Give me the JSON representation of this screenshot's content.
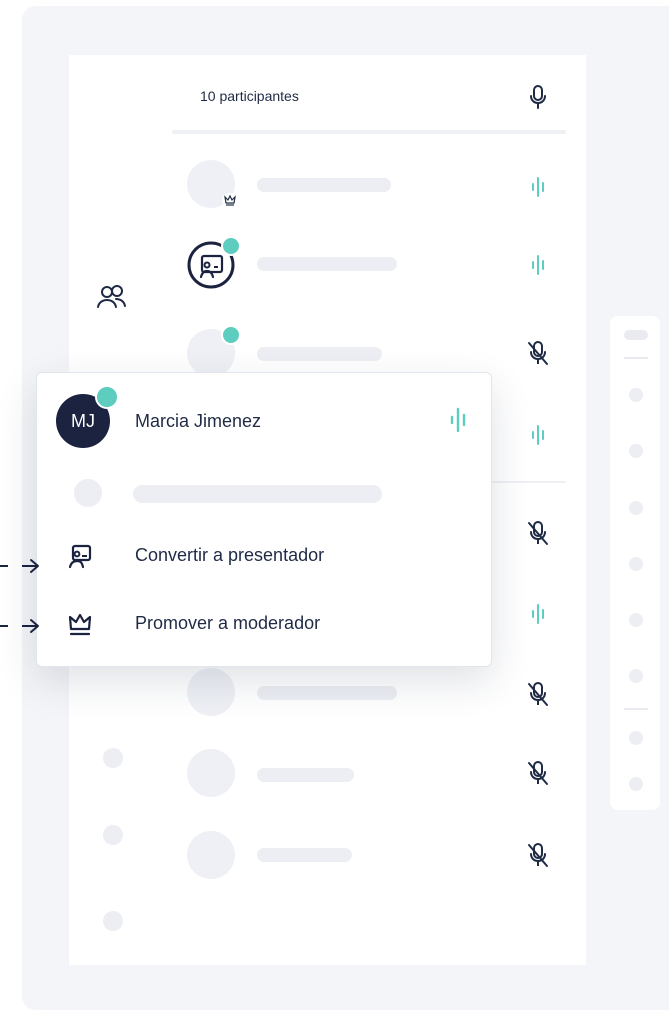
{
  "participants": {
    "count_label": "10 participantes",
    "highlighted": {
      "initials": "MJ",
      "name": "Marcia Jimenez"
    }
  },
  "context_menu": {
    "items": [
      {
        "label": "Convertir a presentador",
        "icon": "presenter-icon"
      },
      {
        "label": "Promover a moderador",
        "icon": "crown-icon"
      }
    ]
  },
  "colors": {
    "accent": "#5ccdbe",
    "text": "#1f2a44",
    "avatar_bg": "#1b2340",
    "placeholder": "#eceef3"
  }
}
